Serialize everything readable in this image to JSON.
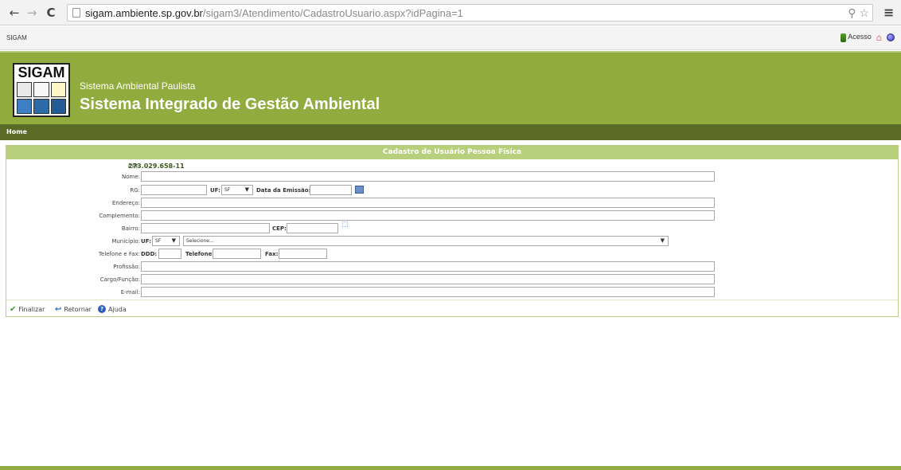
{
  "browser": {
    "url_domain": "sigam.ambiente.sp.gov.br",
    "url_path": "/sigam3/Atendimento/CadastroUsuario.aspx?idPagina=1"
  },
  "topstrip": {
    "title": "SIGAM",
    "acesso_label": "Acesso"
  },
  "header": {
    "logo_text": "SIGAM",
    "subtitle": "Sistema Ambiental Paulista",
    "title": "Sistema Integrado de Gestão Ambiental"
  },
  "nav": {
    "home": "Home"
  },
  "form": {
    "title": "Cadastro de Usuário Pessoa Física",
    "cpf_label": "CPF:",
    "cpf_value": "273.029.658-11",
    "nome_label": "Nome:",
    "rg_label": "RG:",
    "uf_label": "UF:",
    "uf_value": "SF",
    "emissao_label": "Data da Emissão:",
    "endereco_label": "Endereço:",
    "complemento_label": "Complemento:",
    "bairro_label": "Bairro:",
    "cep_label": "CEP:",
    "municipio_label": "Município:",
    "municipio_uf_label": "UF:",
    "municipio_uf_value": "SF",
    "municipio_value": "Selecione...",
    "telefone_fax_label": "Telefone e Fax:",
    "ddd_label": "DDD:",
    "telefone_label": "Telefone:",
    "fax_label": "Fax:",
    "profissao_label": "Profissão:",
    "cargo_label": "Cargo/Função:",
    "email_label": "E-mail:"
  },
  "actions": {
    "finalizar": "Finalizar",
    "retornar": "Retornar",
    "ajuda": "Ajuda"
  },
  "colors": {
    "header_green": "#92ab3e",
    "nav_dark": "#5c6a28",
    "form_title_green": "#b8cf7c"
  }
}
